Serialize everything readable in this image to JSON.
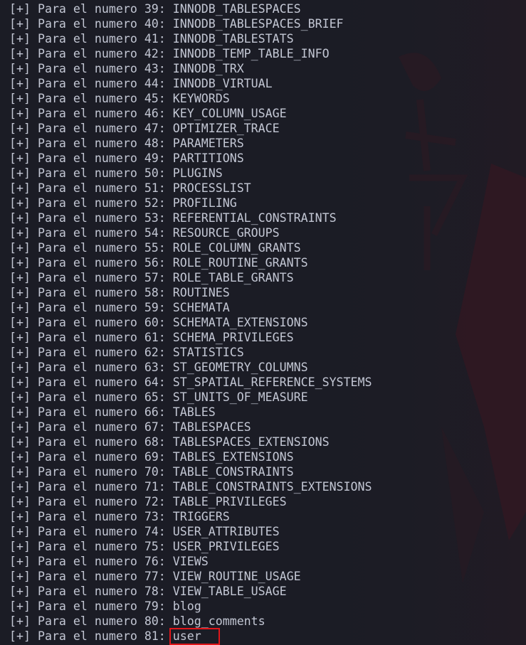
{
  "terminal": {
    "lines": [
      {
        "prefix": "[+] Para el numero 39: ",
        "name": "INNODB_TABLESPACES"
      },
      {
        "prefix": "[+] Para el numero 40: ",
        "name": "INNODB_TABLESPACES_BRIEF"
      },
      {
        "prefix": "[+] Para el numero 41: ",
        "name": "INNODB_TABLESTATS"
      },
      {
        "prefix": "[+] Para el numero 42: ",
        "name": "INNODB_TEMP_TABLE_INFO"
      },
      {
        "prefix": "[+] Para el numero 43: ",
        "name": "INNODB_TRX"
      },
      {
        "prefix": "[+] Para el numero 44: ",
        "name": "INNODB_VIRTUAL"
      },
      {
        "prefix": "[+] Para el numero 45: ",
        "name": "KEYWORDS"
      },
      {
        "prefix": "[+] Para el numero 46: ",
        "name": "KEY_COLUMN_USAGE"
      },
      {
        "prefix": "[+] Para el numero 47: ",
        "name": "OPTIMIZER_TRACE"
      },
      {
        "prefix": "[+] Para el numero 48: ",
        "name": "PARAMETERS"
      },
      {
        "prefix": "[+] Para el numero 49: ",
        "name": "PARTITIONS"
      },
      {
        "prefix": "[+] Para el numero 50: ",
        "name": "PLUGINS"
      },
      {
        "prefix": "[+] Para el numero 51: ",
        "name": "PROCESSLIST"
      },
      {
        "prefix": "[+] Para el numero 52: ",
        "name": "PROFILING"
      },
      {
        "prefix": "[+] Para el numero 53: ",
        "name": "REFERENTIAL_CONSTRAINTS"
      },
      {
        "prefix": "[+] Para el numero 54: ",
        "name": "RESOURCE_GROUPS"
      },
      {
        "prefix": "[+] Para el numero 55: ",
        "name": "ROLE_COLUMN_GRANTS"
      },
      {
        "prefix": "[+] Para el numero 56: ",
        "name": "ROLE_ROUTINE_GRANTS"
      },
      {
        "prefix": "[+] Para el numero 57: ",
        "name": "ROLE_TABLE_GRANTS"
      },
      {
        "prefix": "[+] Para el numero 58: ",
        "name": "ROUTINES"
      },
      {
        "prefix": "[+] Para el numero 59: ",
        "name": "SCHEMATA"
      },
      {
        "prefix": "[+] Para el numero 60: ",
        "name": "SCHEMATA_EXTENSIONS"
      },
      {
        "prefix": "[+] Para el numero 61: ",
        "name": "SCHEMA_PRIVILEGES"
      },
      {
        "prefix": "[+] Para el numero 62: ",
        "name": "STATISTICS"
      },
      {
        "prefix": "[+] Para el numero 63: ",
        "name": "ST_GEOMETRY_COLUMNS"
      },
      {
        "prefix": "[+] Para el numero 64: ",
        "name": "ST_SPATIAL_REFERENCE_SYSTEMS"
      },
      {
        "prefix": "[+] Para el numero 65: ",
        "name": "ST_UNITS_OF_MEASURE"
      },
      {
        "prefix": "[+] Para el numero 66: ",
        "name": "TABLES"
      },
      {
        "prefix": "[+] Para el numero 67: ",
        "name": "TABLESPACES"
      },
      {
        "prefix": "[+] Para el numero 68: ",
        "name": "TABLESPACES_EXTENSIONS"
      },
      {
        "prefix": "[+] Para el numero 69: ",
        "name": "TABLES_EXTENSIONS"
      },
      {
        "prefix": "[+] Para el numero 70: ",
        "name": "TABLE_CONSTRAINTS"
      },
      {
        "prefix": "[+] Para el numero 71: ",
        "name": "TABLE_CONSTRAINTS_EXTENSIONS"
      },
      {
        "prefix": "[+] Para el numero 72: ",
        "name": "TABLE_PRIVILEGES"
      },
      {
        "prefix": "[+] Para el numero 73: ",
        "name": "TRIGGERS"
      },
      {
        "prefix": "[+] Para el numero 74: ",
        "name": "USER_ATTRIBUTES"
      },
      {
        "prefix": "[+] Para el numero 75: ",
        "name": "USER_PRIVILEGES"
      },
      {
        "prefix": "[+] Para el numero 76: ",
        "name": "VIEWS"
      },
      {
        "prefix": "[+] Para el numero 77: ",
        "name": "VIEW_ROUTINE_USAGE"
      },
      {
        "prefix": "[+] Para el numero 78: ",
        "name": "VIEW_TABLE_USAGE"
      },
      {
        "prefix": "[+] Para el numero 79: ",
        "name": "blog"
      },
      {
        "prefix": "[+] Para el numero 80: ",
        "name": "blog_comments"
      },
      {
        "prefix": "[+] Para el numero 81: ",
        "name": "user",
        "highlighted": true
      }
    ]
  },
  "colors": {
    "background": "#1b1c25",
    "text": "#c3c7d4",
    "highlight_box": "#e0161a",
    "wallpaper_accent": "#3a1620"
  }
}
